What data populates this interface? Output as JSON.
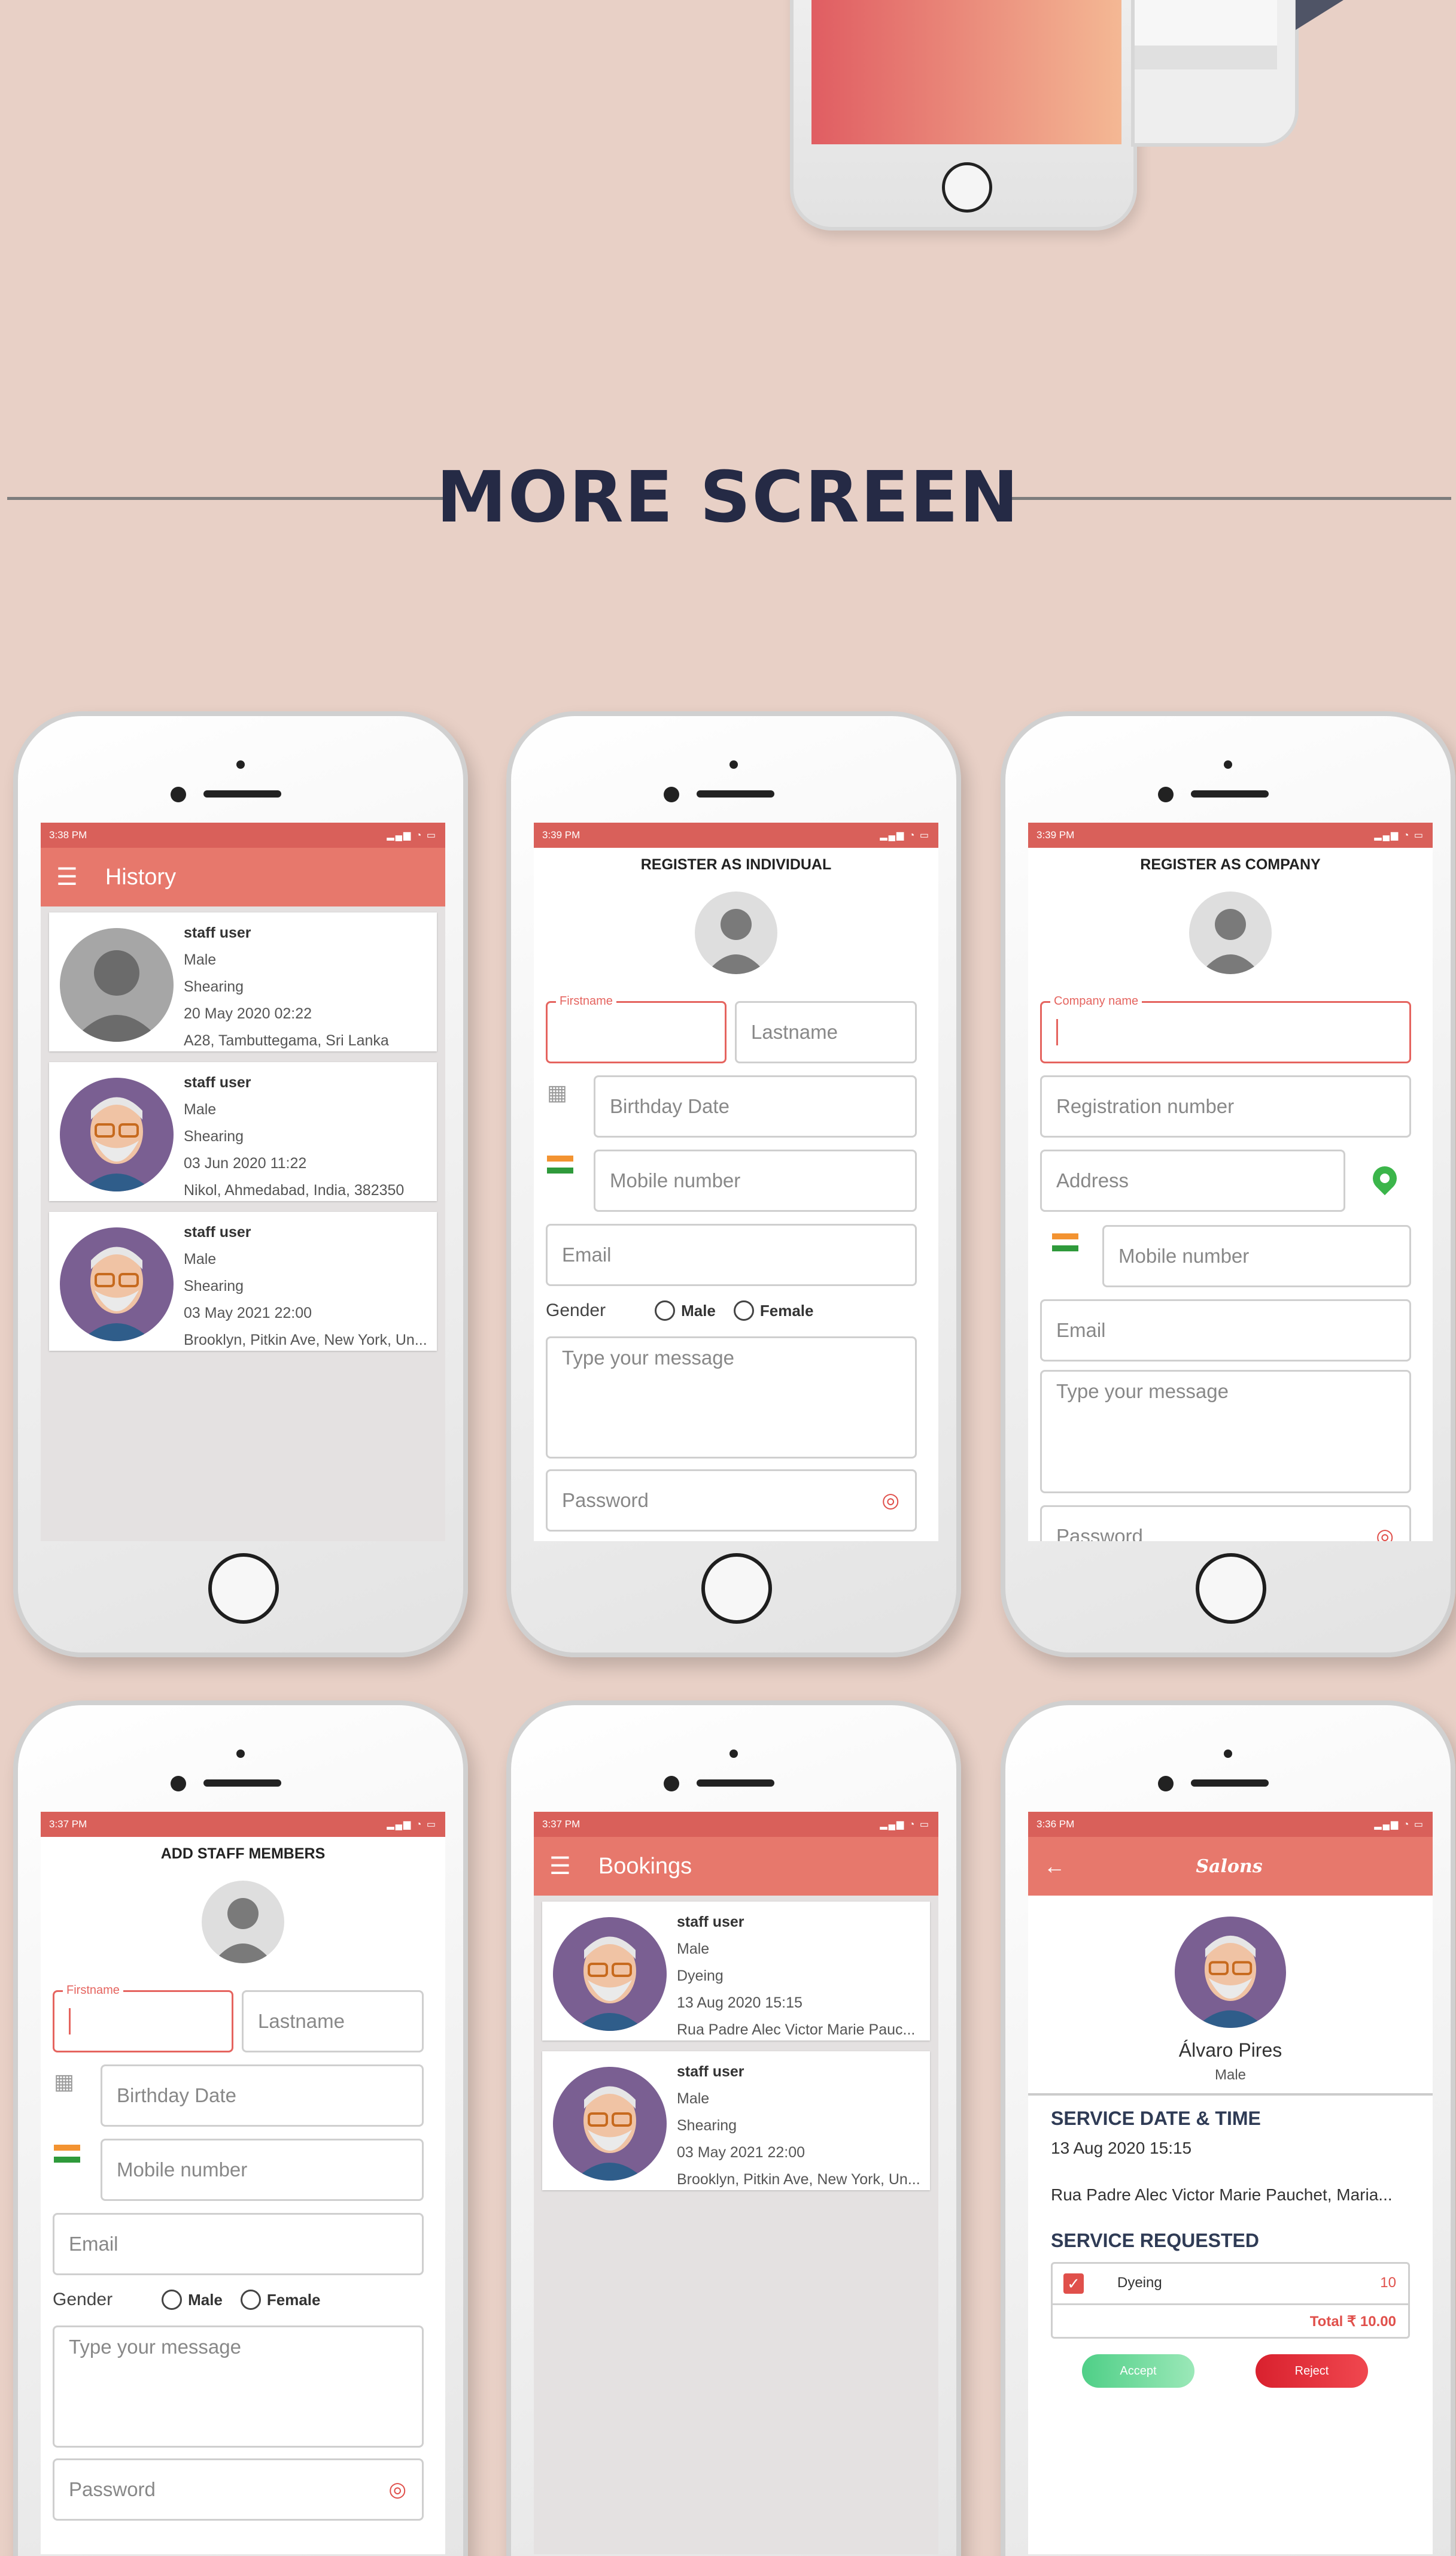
{
  "heading": "MORE SCREEN",
  "colors": {
    "accent": "#e7786c",
    "status_bar": "#d9605a",
    "background": "#e8d0c6",
    "heading": "#252a45"
  },
  "history": {
    "time": "3:38 PM",
    "title": "History",
    "items": [
      {
        "name": "staff user",
        "gender": "Male",
        "service": "Shearing",
        "date": "20 May 2020 02:22",
        "address": "A28, Tambuttegama, Sri Lanka"
      },
      {
        "name": "staff user",
        "gender": "Male",
        "service": "Shearing",
        "date": "03 Jun 2020 11:22",
        "address": "Nikol, Ahmedabad, India, 382350"
      },
      {
        "name": "staff user",
        "gender": "Male",
        "service": "Shearing",
        "date": "03 May 2021 22:00",
        "address": "Brooklyn, Pitkin Ave, New York, Un..."
      }
    ]
  },
  "register_individual": {
    "time": "3:39 PM",
    "title": "REGISTER AS INDIVIDUAL",
    "firstname_label": "Firstname",
    "lastname": "Lastname",
    "birthday": "Birthday Date",
    "mobile": "Mobile number",
    "email": "Email",
    "gender": "Gender",
    "male": "Male",
    "female": "Female",
    "message": "Type your message",
    "password": "Password"
  },
  "register_company": {
    "time": "3:39 PM",
    "title": "REGISTER AS COMPANY",
    "company_label": "Company name",
    "registration": "Registration number",
    "address": "Address",
    "mobile": "Mobile number",
    "email": "Email",
    "message": "Type your message",
    "password": "Password"
  },
  "add_staff": {
    "time": "3:37 PM",
    "title": "ADD STAFF MEMBERS",
    "firstname_label": "Firstname",
    "lastname": "Lastname",
    "birthday": "Birthday Date",
    "mobile": "Mobile number",
    "email": "Email",
    "gender": "Gender",
    "male": "Male",
    "female": "Female",
    "message": "Type your message",
    "password": "Password"
  },
  "bookings": {
    "time": "3:37 PM",
    "title": "Bookings",
    "items": [
      {
        "name": "staff user",
        "gender": "Male",
        "service": "Dyeing",
        "date": "13 Aug 2020 15:15",
        "address": "Rua Padre Alec Victor Marie Pauc..."
      },
      {
        "name": "staff user",
        "gender": "Male",
        "service": "Shearing",
        "date": "03 May 2021 22:00",
        "address": "Brooklyn, Pitkin Ave, New York, Un..."
      }
    ]
  },
  "salon": {
    "time": "3:36 PM",
    "title": "Salons",
    "person": "Álvaro Pires",
    "gender": "Male",
    "date_heading": "SERVICE DATE & TIME",
    "date": "13 Aug 2020 15:15",
    "address": "Rua Padre Alec Victor Marie Pauchet, Maria...",
    "requested_heading": "SERVICE REQUESTED",
    "service": "Dyeing",
    "price": "10",
    "total": "Total ₹ 10.00",
    "accept": "Accept",
    "reject": "Reject"
  }
}
